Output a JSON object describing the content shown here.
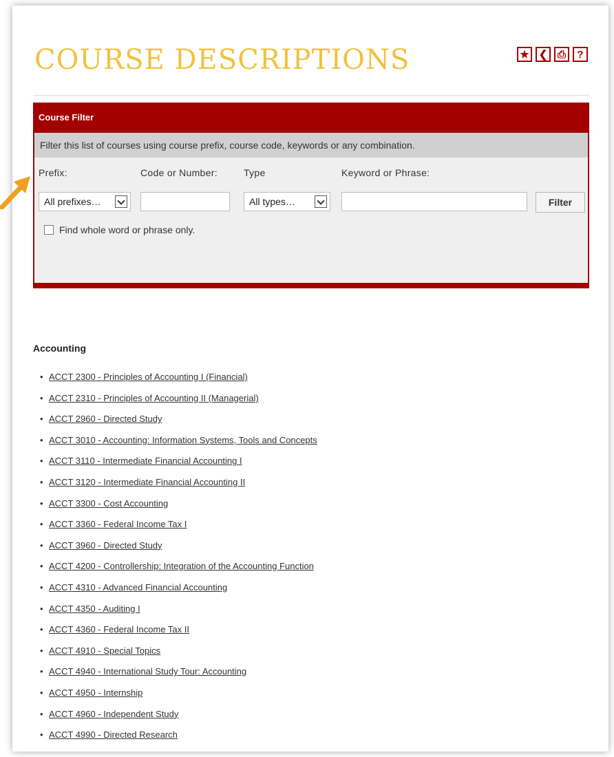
{
  "page": {
    "title": "COURSE DESCRIPTIONS",
    "tools": [
      {
        "name": "favorite",
        "icon": "star-icon",
        "glyph": "★"
      },
      {
        "name": "share",
        "icon": "share-icon",
        "glyph": "❮"
      },
      {
        "name": "print",
        "icon": "print-icon",
        "glyph": "⎙"
      },
      {
        "name": "help",
        "icon": "help-icon",
        "glyph": "?"
      }
    ]
  },
  "filter": {
    "heading": "Course Filter",
    "description": "Filter this list of courses using course prefix, course code, keywords or any combination.",
    "prefix_label": "Prefix:",
    "code_label": "Code or Number:",
    "type_label": "Type",
    "keyword_label": "Keyword or Phrase:",
    "prefix_value": "All prefixes…",
    "code_value": "",
    "type_value": "All types…",
    "keyword_value": "",
    "button_label": "Filter",
    "whole_word_label": "Find whole word or phrase only.",
    "whole_word_checked": false
  },
  "colors": {
    "title": "#f2c13d",
    "accent": "#a30000",
    "pointer_arrow": "#f0a11e"
  },
  "section": {
    "heading": "Accounting",
    "courses": [
      "ACCT 2300 - Principles of Accounting I (Financial)",
      "ACCT 2310 - Principles of Accounting II (Managerial)",
      "ACCT 2960 - Directed Study",
      "ACCT 3010 - Accounting: Information Systems, Tools and Concepts",
      "ACCT 3110 - Intermediate Financial Accounting I",
      "ACCT 3120 - Intermediate Financial Accounting II",
      "ACCT 3300 - Cost Accounting",
      "ACCT 3360 - Federal Income Tax I",
      "ACCT 3960 - Directed Study",
      "ACCT 4200 - Controllership: Integration of the Accounting Function",
      "ACCT 4310 - Advanced Financial Accounting",
      "ACCT 4350 - Auditing I",
      "ACCT 4360 - Federal Income Tax II",
      "ACCT 4910 - Special Topics",
      "ACCT 4940 - International Study Tour: Accounting",
      "ACCT 4950 - Internship",
      "ACCT 4960 - Independent Study",
      "ACCT 4990 - Directed Research"
    ]
  }
}
